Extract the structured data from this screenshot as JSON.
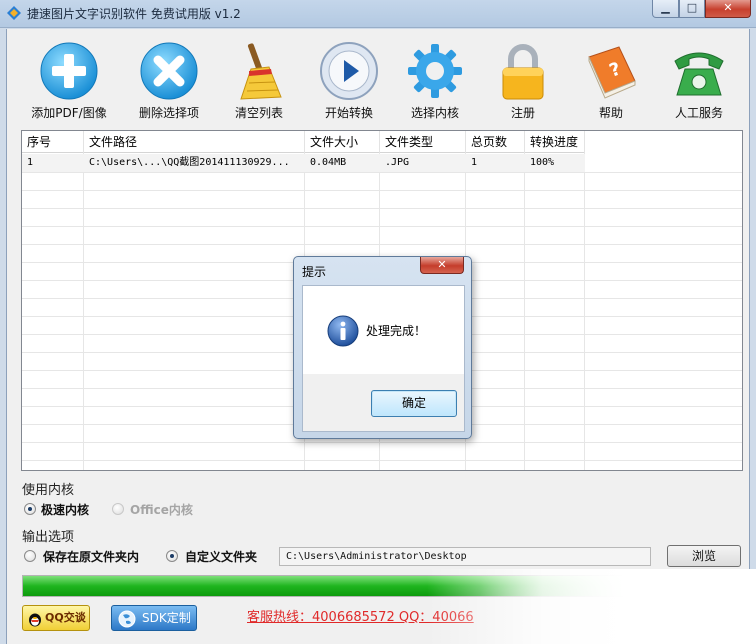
{
  "window": {
    "title": "捷速图片文字识别软件 免费试用版 v1.2",
    "min_glyph": "▁",
    "max_glyph": "□",
    "close_glyph": "✕"
  },
  "toolbar": {
    "add": "添加PDF/图像",
    "delete": "删除选择项",
    "clear": "清空列表",
    "start": "开始转换",
    "engine": "选择内核",
    "register": "注册",
    "help": "帮助",
    "service": "人工服务"
  },
  "table": {
    "headers": [
      "序号",
      "文件路径",
      "文件大小",
      "文件类型",
      "总页数",
      "转换进度"
    ],
    "rows": [
      [
        "1",
        "C:\\Users\\...\\QQ截图201411130929...",
        "0.04MB",
        ".JPG",
        "1",
        "100%"
      ]
    ]
  },
  "engine_section": {
    "title": "使用内核",
    "fast": "极速内核",
    "office": "Office内核"
  },
  "output_section": {
    "title": "输出选项",
    "original_folder": "保存在原文件夹内",
    "custom_folder": "自定义文件夹",
    "path_value": "C:\\Users\\Administrator\\Desktop",
    "browse": "浏览"
  },
  "progress": {
    "value": 1.0
  },
  "bottom": {
    "qq": "QQ交谈",
    "sdk": "SDK定制",
    "hotline": "客服热线：4006685572 QQ：40066"
  },
  "dialog": {
    "title": "提示",
    "message": "处理完成！",
    "ok": "确定",
    "close_glyph": "✕"
  },
  "colors": {
    "title_bar": "#b9cde4",
    "progress_green": "#1fb51f",
    "hotline_red": "#e02a2a"
  }
}
